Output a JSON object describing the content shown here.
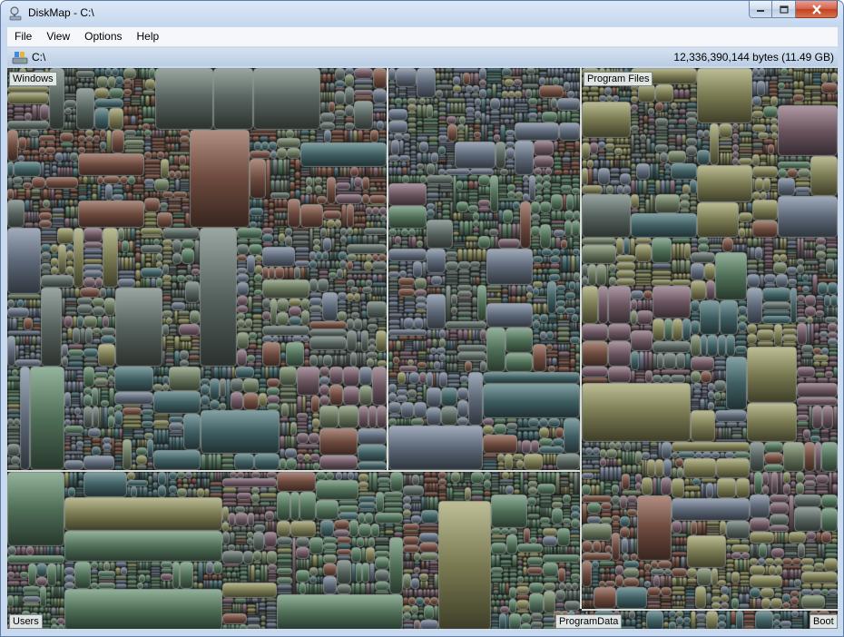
{
  "window": {
    "title": "DiskMap - C:\\",
    "icons": {
      "app": "disk-magnifier-icon",
      "minimize": "minimize-icon",
      "maximize": "maximize-icon",
      "close": "close-icon"
    }
  },
  "menu": {
    "items": [
      {
        "label": "File"
      },
      {
        "label": "View"
      },
      {
        "label": "Options"
      },
      {
        "label": "Help"
      }
    ]
  },
  "pathbar": {
    "icon": "drive-folder-icon",
    "path": "C:\\",
    "size": "12,336,390,144 bytes (11.49 GB)"
  },
  "treemap": {
    "regions": [
      {
        "label": "Windows"
      },
      {
        "label": "Program Files"
      },
      {
        "label": "Users"
      },
      {
        "label": "ProgramData"
      },
      {
        "label": "Boot"
      }
    ],
    "palette": [
      "#56625d",
      "#7a7a52",
      "#4f6f58",
      "#6b5560",
      "#5d6878",
      "#6d4a3e",
      "#3f5f63",
      "#65735a"
    ]
  }
}
